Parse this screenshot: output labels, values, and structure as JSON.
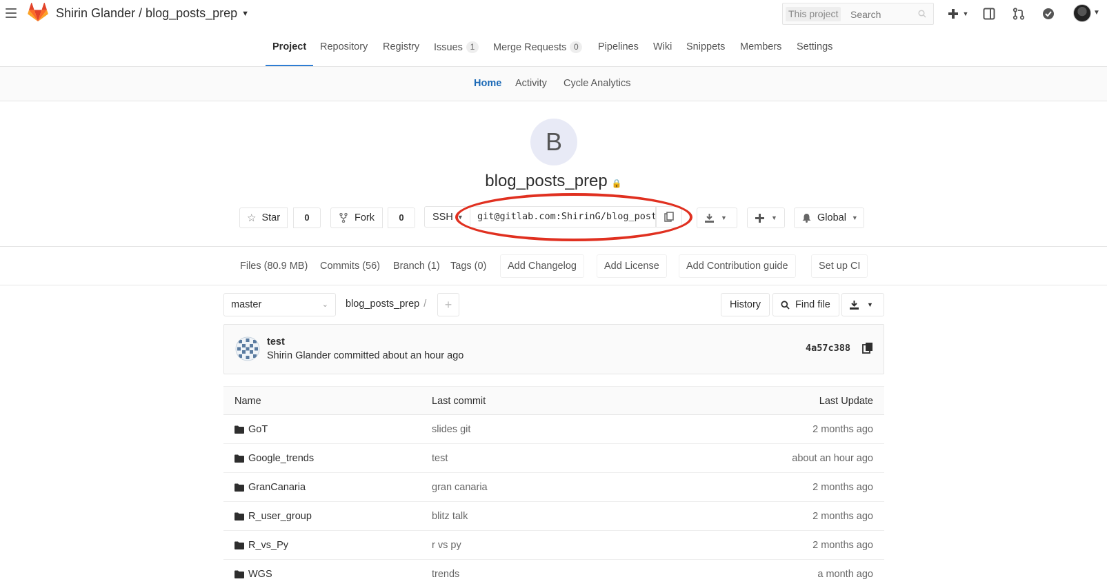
{
  "header": {
    "title": "Shirin Glander / blog_posts_prep",
    "search_scope": "This project",
    "search_placeholder": "Search"
  },
  "main_nav": {
    "items": [
      {
        "label": "Project"
      },
      {
        "label": "Repository"
      },
      {
        "label": "Registry"
      },
      {
        "label": "Issues",
        "badge": "1"
      },
      {
        "label": "Merge Requests",
        "badge": "0"
      },
      {
        "label": "Pipelines"
      },
      {
        "label": "Wiki"
      },
      {
        "label": "Snippets"
      },
      {
        "label": "Members"
      },
      {
        "label": "Settings"
      }
    ],
    "active": "Project"
  },
  "sub_nav": {
    "items": [
      "Home",
      "Activity",
      "Cycle Analytics"
    ],
    "active": "Home"
  },
  "project": {
    "avatar_letter": "B",
    "name": "blog_posts_prep",
    "star_label": "Star",
    "star_count": "0",
    "fork_label": "Fork",
    "fork_count": "0",
    "protocol": "SSH",
    "clone_url": "git@gitlab.com:ShirinG/blog_posts_prep.git",
    "notification_label": "Global"
  },
  "stats": {
    "files": "Files (80.9 MB)",
    "commits": "Commits (56)",
    "branch": "Branch (1)",
    "tags": "Tags (0)",
    "add_changelog": "Add Changelog",
    "add_license": "Add License",
    "add_contribution": "Add Contribution guide",
    "setup_ci": "Set up CI"
  },
  "tree": {
    "branch": "master",
    "path": "blog_posts_prep",
    "history_label": "History",
    "find_file_label": "Find file"
  },
  "last_commit": {
    "title": "test",
    "meta": "Shirin Glander committed about an hour ago",
    "sha": "4a57c388"
  },
  "table": {
    "headers": {
      "name": "Name",
      "last_commit": "Last commit",
      "last_update": "Last Update"
    },
    "rows": [
      {
        "name": "GoT",
        "commit": "slides git",
        "updated": "2 months ago"
      },
      {
        "name": "Google_trends",
        "commit": "test",
        "updated": "about an hour ago"
      },
      {
        "name": "GranCanaria",
        "commit": "gran canaria",
        "updated": "2 months ago"
      },
      {
        "name": "R_user_group",
        "commit": "blitz talk",
        "updated": "2 months ago"
      },
      {
        "name": "R_vs_Py",
        "commit": "r vs py",
        "updated": "2 months ago"
      },
      {
        "name": "WGS",
        "commit": "trends",
        "updated": "a month ago"
      }
    ]
  },
  "colors": {
    "accent": "#1b69b6",
    "active_underline": "#2e7dd3",
    "annotation_ellipse": "#e03020"
  }
}
